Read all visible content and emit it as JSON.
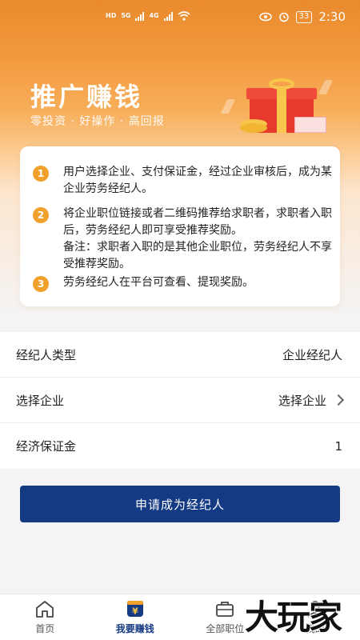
{
  "status_bar": {
    "left_labels": [
      "HD",
      "HD",
      "5G",
      "4G"
    ],
    "battery": "33",
    "time": "2:30"
  },
  "banner": {
    "title": "推广赚钱",
    "subtitle": "零投资 · 好操作 · 高回报"
  },
  "steps": [
    {
      "num": "1",
      "text": "用户选择企业、支付保证金，经过企业审核后，成为某企业劳务经纪人。"
    },
    {
      "num": "2",
      "text": "将企业职位链接或者二维码推荐给求职者，求职者入职后，劳务经纪人即可享受推荐奖励。",
      "note": "备注：求职者入职的是其他企业职位，劳务经纪人不享受推荐奖励。"
    },
    {
      "num": "3",
      "text": "劳务经纪人在平台可查看、提现奖励。"
    }
  ],
  "form": {
    "broker_type": {
      "label": "经纪人类型",
      "value": "企业经纪人"
    },
    "select_company": {
      "label": "选择企业",
      "value": "选择企业"
    },
    "deposit": {
      "label": "经济保证金",
      "value": "1"
    }
  },
  "apply_button": "申请成为经纪人",
  "nav": {
    "items": [
      {
        "label": "首页",
        "icon": "home-icon"
      },
      {
        "label": "我要赚钱",
        "icon": "money-icon",
        "active": true
      },
      {
        "label": "全部职位",
        "icon": "briefcase-icon"
      },
      {
        "label": "我的",
        "icon": "profile-icon"
      }
    ]
  },
  "watermark": "大玩家",
  "colors": {
    "accent_orange": "#f0a12b",
    "primary_blue": "#153a84"
  }
}
